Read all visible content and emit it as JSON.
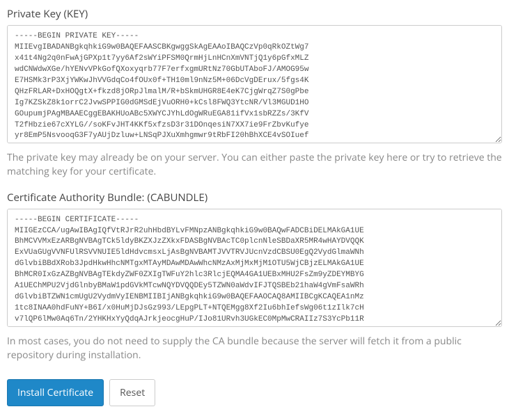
{
  "private_key": {
    "label": "Private Key (KEY)",
    "value": "-----BEGIN PRIVATE KEY-----\nMIIEvgIBADANBgkqhkiG9w0BAQEFAASCBKgwggSkAgEAAoIBAQCzVp0qRkOZtWg7\nx41t4Ng2q0nFwAjGPXp1t7yy6Af2sWYiPFSM0QrmHjLnHCnXmVNTjQ1y6pGfxMLZ\nwdCNWdwXGe/hYENvVPkGofQXoxyqrb77F7erfxgmURtNz70GbUTAboFJ/AMOG95w\nE7HSMk3rP3XjYWKwJhVVGdqCo4fOUx0f+TH10ml9nNz5M+06DcVgDErux/5fgs4K\nQHzFRLAR+DxHOQgtX+fkzd8jORpJlmalM/R+bSkmUHGR8E4eK7CjgWrqZ7S0gPbe\nIg7KZSkZ8k1orrC2JvwSPPIG0dGMSdEjVuORH0+kCsl8FWQ3YtcNR/Vl3MGUD1HO\nGOupumjPAgMBAAECggEBAKHUoABc5XWYCJYhLdOgWRuEGA81ifVx1sbRZZs/3KfV\nT2fHbzie67cXYLG//soKFvJHT4KKf5xfzsD3r31DOnqesiN7XX7ie9FrZbvKufye\nyr8EmP5NsvooqG3F7yAUjDzluw+LNSqPJXuXmhgmwr9tRbFI20hBhXCE4vSOIuef",
    "help": "The private key may already be on your server. You can either paste the private key here or try to retrieve the matching key for your certificate."
  },
  "ca_bundle": {
    "label": "Certificate Authority Bundle: (CABUNDLE)",
    "value": "-----BEGIN CERTIFICATE-----\nMIIGEzCCA/ugAwIBAgIQfVtRJrR2uhHbdBYLvFMNpzANBgkqhkiG9w0BAQwFADCBiDELMAkGA1UE\nBhMCVVMxEzARBgNVBAgTCk5ldyBKZXJzZXkxFDASBgNVBAcTC0plcnNleSBDaXR5MR4wHAYDVQQK\nExVUaGUgVVNFUlRSVVNUIE5ldHdvcmsxLjAsBgNVBAMTJVVTRVJUcnVzdCBSU0EgQ2VydGlmaWNh\ndGlvbiBBdXRob3JpdHkwHhcNMTgxMTAyMDAwMDAwWhcNMzAxMjMxMjM1OTU5WjCBjzELMAkGA1UE\nBhMCR0IxGzAZBgNVBAgTEkdyZWF0ZXIgTWFuY2hlc3RlcjEQMA4GA1UEBxMHU2FsZm9yZDEYMBYG\nA1UEChMPU2VjdGlnbyBMaW1pdGVkMTcwNQYDVQQDEy5TZWN0aWdvIFJTQSBEb21haW4gVmFsaWRh\ndGlvbiBTZWN1cmUgU2VydmVyIENBMIIBIjANBgkqhkiG9w0BAQEFAAOCAQ8AMIIBCgKCAQEA1nMz\n1tc8INAA0hdFuNY+B6I/x0HuMjDJsGz993/LEpgPLT+NTQEMgg8Xf2Iu6bhIefsWg06t1zIlk7cH\nv7lQP6lMw0Aq6Tn/2YHKHxYyQdqAJrkjeocgHuP/IJo81URvh3UGkEC0MpMwCRAIIz7S3YcPb11R",
    "help": "In most cases, you do not need to supply the CA bundle because the server will fetch it from a public repository during installation."
  },
  "buttons": {
    "install_label": "Install Certificate",
    "reset_label": "Reset"
  }
}
